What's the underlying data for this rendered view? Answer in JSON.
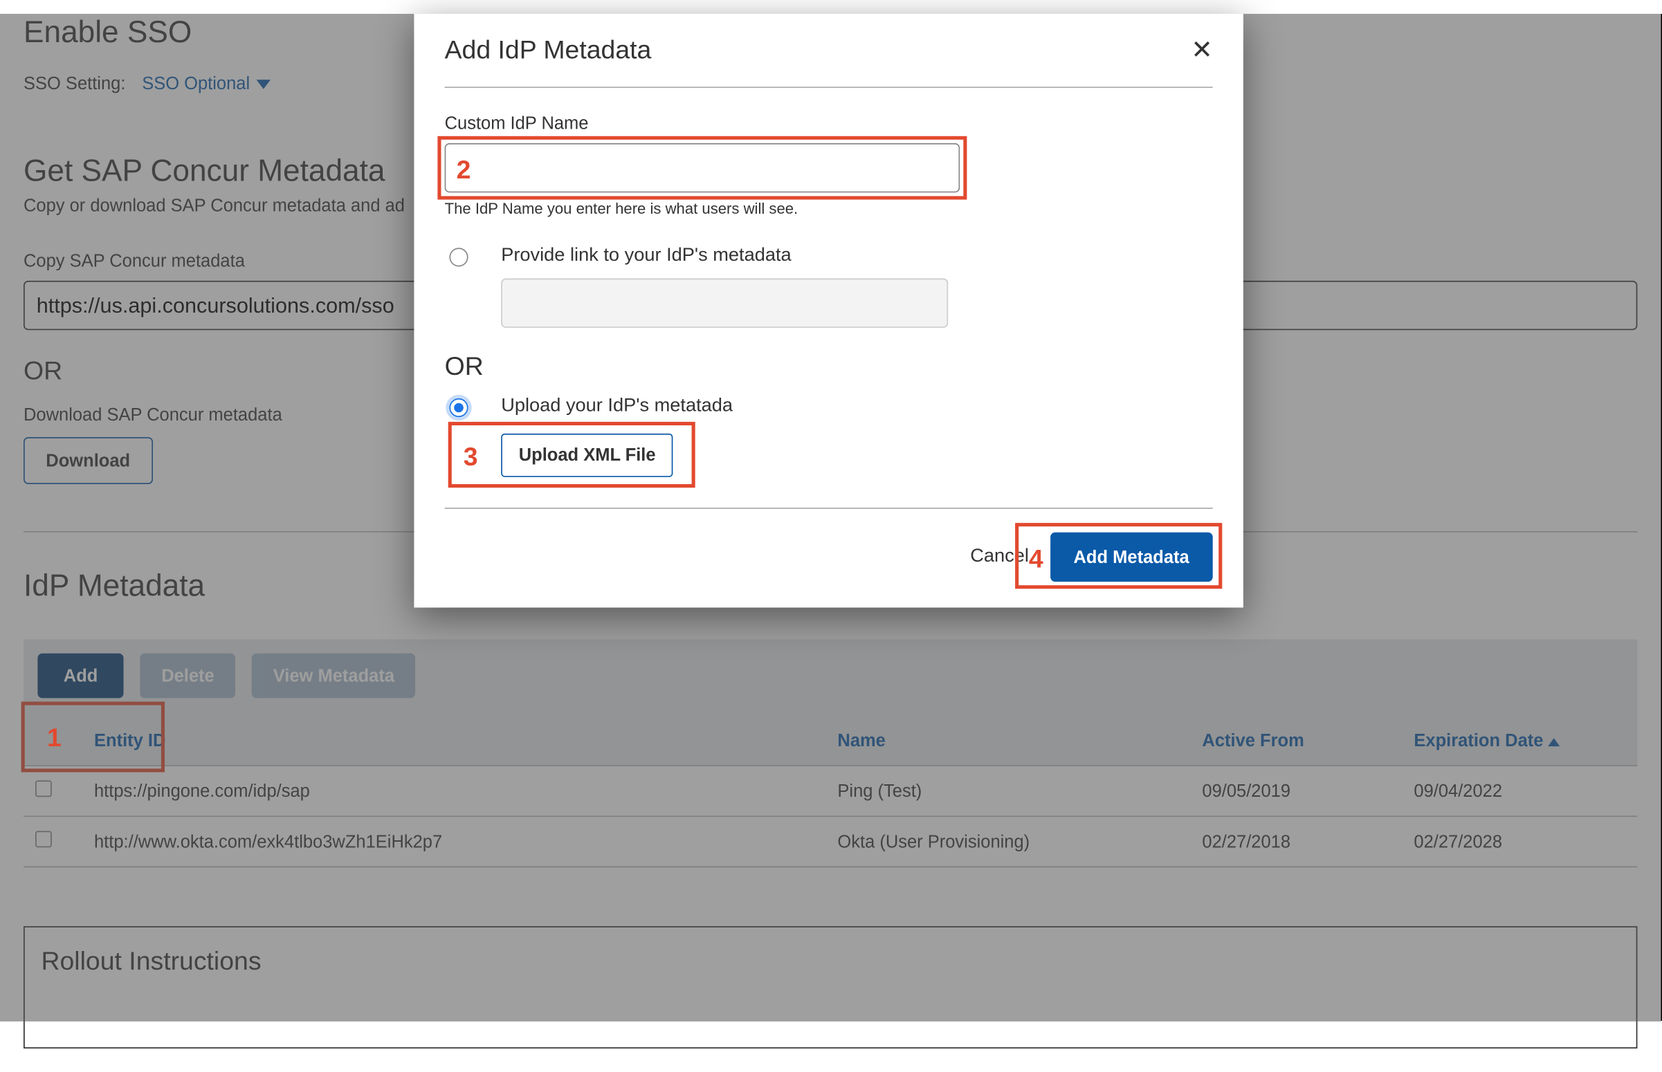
{
  "page": {
    "enable_heading": "Enable SSO",
    "sso_setting_label": "SSO Setting:",
    "sso_setting_value": "SSO Optional",
    "get_heading": "Get SAP Concur Metadata",
    "get_subtitle": "Copy or download SAP Concur metadata and ad",
    "copy_label": "Copy SAP Concur metadata",
    "metadata_url": "https://us.api.concursolutions.com/sso",
    "or_label": "OR",
    "download_label": "Download SAP Concur metadata",
    "download_button": "Download",
    "idp_heading": "IdP Metadata",
    "toolbar": {
      "add": "Add",
      "delete": "Delete",
      "view": "View Metadata"
    },
    "table": {
      "headers": {
        "entity": "Entity ID",
        "name": "Name",
        "active_from": "Active From",
        "expiration": "Expiration Date"
      },
      "rows": [
        {
          "entity": "https://pingone.com/idp/sap",
          "name": "Ping (Test)",
          "active_from": "09/05/2019",
          "expiration": "09/04/2022"
        },
        {
          "entity": "http://www.okta.com/exk4tlbo3wZh1EiHk2p7",
          "name": "Okta (User Provisioning)",
          "active_from": "02/27/2018",
          "expiration": "02/27/2028"
        }
      ]
    },
    "rollout_heading": "Rollout Instructions"
  },
  "modal": {
    "title": "Add IdP Metadata",
    "custom_label": "Custom IdP Name",
    "custom_helper": "The IdP Name you enter here is what users will see.",
    "provide_link_label": "Provide link to your IdP's metadata",
    "or_label": "OR",
    "upload_label": "Upload your IdP's metatada",
    "upload_button": "Upload XML File",
    "cancel": "Cancel",
    "submit": "Add Metadata"
  },
  "annotations": {
    "n1": "1",
    "n2": "2",
    "n3": "3",
    "n4": "4"
  }
}
